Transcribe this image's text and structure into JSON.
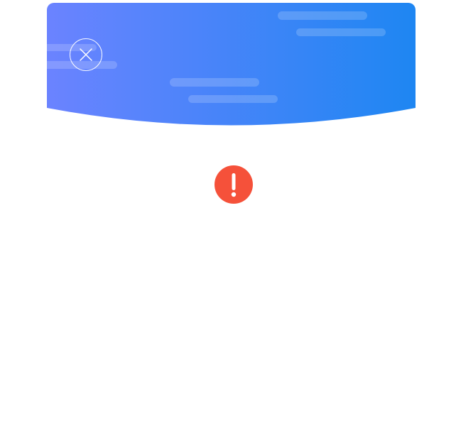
{
  "header": {
    "gradient": {
      "start": "#6B83FF",
      "end": "#1E86F2"
    },
    "cloud_color": "#FFFFFF"
  },
  "close_control": {
    "icon": "close-icon",
    "color": "#FFFFFF"
  },
  "status": {
    "icon": "exclamation-icon",
    "color": "#F5513A",
    "glyph_color": "#FFFFFF"
  }
}
